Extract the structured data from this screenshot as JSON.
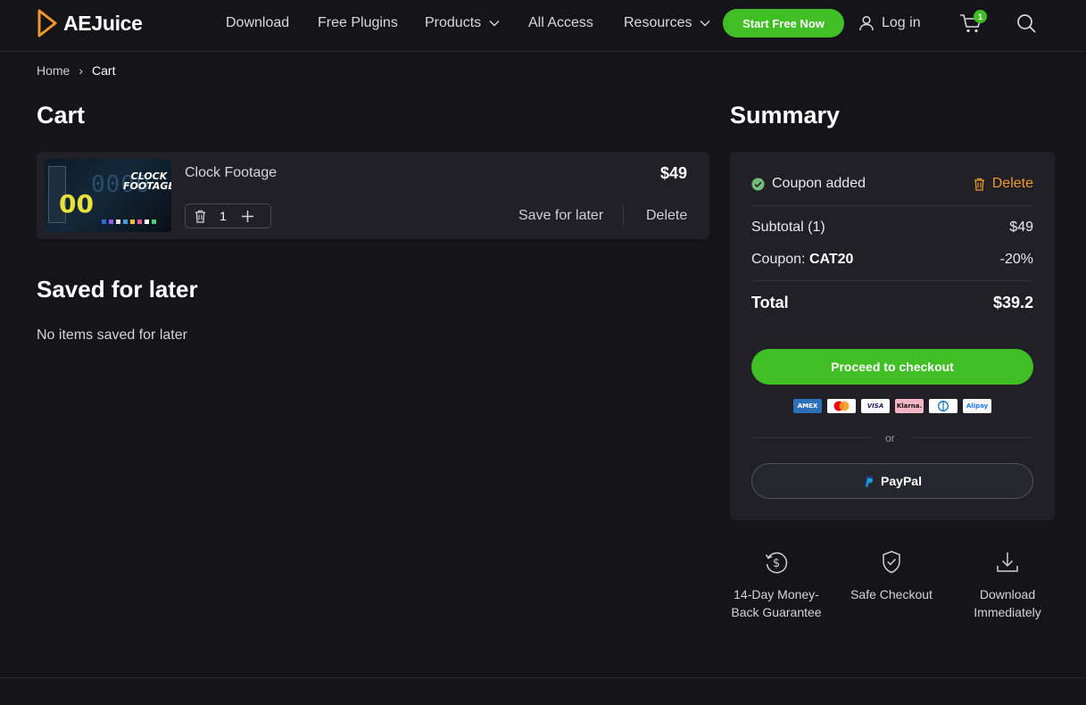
{
  "brand": {
    "name": "AEJuice",
    "accent": "#3fbf23",
    "logo_color": "#f0982a"
  },
  "nav": {
    "download": "Download",
    "free_plugins": "Free Plugins",
    "products": "Products",
    "all_access": "All Access",
    "resources": "Resources",
    "cta": "Start Free Now",
    "login": "Log in",
    "cart_count": "1"
  },
  "breadcrumb": {
    "home": "Home",
    "separator": "›",
    "current": "Cart"
  },
  "cart": {
    "title": "Cart",
    "item": {
      "name": "Clock Footage",
      "price": "$49",
      "quantity": "1",
      "save_for_later": "Save for later",
      "delete": "Delete",
      "thumbnail": {
        "title_line1": "CLOCK",
        "title_line2": "FOOTAGE",
        "big": "00",
        "digits": "0000"
      }
    }
  },
  "saved": {
    "title": "Saved for later",
    "empty": "No items saved for later"
  },
  "summary": {
    "title": "Summary",
    "coupon_added": "Coupon added",
    "coupon_delete": "Delete",
    "subtotal_label": "Subtotal (1)",
    "subtotal_value": "$49",
    "coupon_label": "Coupon:",
    "coupon_code": "CAT20",
    "coupon_value": "-20%",
    "total_label": "Total",
    "total_value": "$39.2",
    "checkout": "Proceed to checkout",
    "payment_methods": [
      "AMEX",
      "Mastercard",
      "VISA",
      "Klarna.",
      "Diners",
      "Alipay"
    ],
    "or": "or",
    "paypal": "PayPal"
  },
  "features": [
    {
      "icon": "money-back-icon",
      "line1": "14-Day Money-",
      "line2": "Back Guarantee"
    },
    {
      "icon": "shield-check-icon",
      "line1": "Safe Checkout",
      "line2": ""
    },
    {
      "icon": "download-icon",
      "line1": "Download",
      "line2": "Immediately"
    }
  ]
}
